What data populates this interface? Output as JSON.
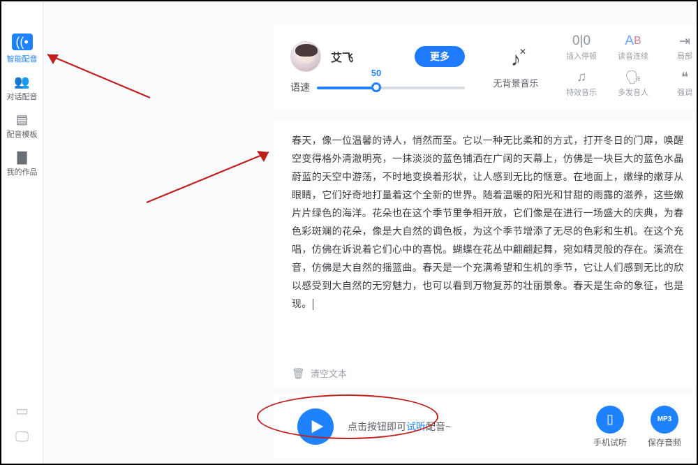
{
  "sidebar": {
    "items": [
      {
        "label": "智能配音",
        "icon": "sound-wave-icon",
        "active": true
      },
      {
        "label": "对话配音",
        "icon": "people-icon",
        "active": false
      },
      {
        "label": "配音模板",
        "icon": "document-icon",
        "active": false
      },
      {
        "label": "我的作品",
        "icon": "folder-icon",
        "active": false
      }
    ],
    "devices": [
      "phone",
      "monitor"
    ]
  },
  "voice": {
    "name": "艾飞",
    "more_label": "更多",
    "speed_label": "语速",
    "speed_value": 50,
    "speed_min": 0,
    "speed_max": 100,
    "bgm_label": "无背景音乐"
  },
  "tools": [
    {
      "name": "insert-pause",
      "icon": "pause-split-icon",
      "label": "插入停顿"
    },
    {
      "name": "continuous-read",
      "icon": "ab-link-icon",
      "label": "读音连续"
    },
    {
      "name": "local",
      "icon": "partial-icon",
      "label": "局部"
    },
    {
      "name": "sfx",
      "icon": "music-note-icon",
      "label": "特效音乐"
    },
    {
      "name": "multi-speaker",
      "icon": "multi-voice-icon",
      "label": "多发音人"
    },
    {
      "name": "emphasis",
      "icon": "emphasis-icon",
      "label": "强调"
    }
  ],
  "essay": {
    "text": "春天，像一位温馨的诗人，悄然而至。它以一种无比柔和的方式，打开冬日的门扉，唤醒\n空变得格外清澈明亮，一抹淡淡的蓝色铺洒在广阔的天幕上，仿佛是一块巨大的蓝色水晶\n蔚蓝的天空中游荡，不时地变换着形状，让人感到无比的惬意。在地面上，嫩绿的嫩芽从\n眼睛，它们好奇地打量着这个全新的世界。随着温暖的阳光和甘甜的雨露的滋养，这些嫩\n片片绿色的海洋。花朵也在这个季节里争相开放，它们像是在进行一场盛大的庆典，为春\n色彩斑斓的花朵，像是大自然的调色板，为这个季节增添了无尽的色彩和生机。在这个充\n唱，仿佛在诉说着它们心中的喜悦。蝴蝶在花丛中翩翩起舞，宛如精灵般的存在。溪流在\n音，仿佛是大自然的摇篮曲。春天是一个充满希望和生机的季节，它让人们感到无比的欣\n以感受到大自然的无穷魅力，也可以看到万物复苏的壮丽景象。春天是生命的象征，也是\n现。"
  },
  "actions": {
    "clear_label": "清空文本",
    "play_hint_pre": "点击按钮即可",
    "play_hint_try": "试听",
    "play_hint_post": "配音~"
  },
  "bottom": [
    {
      "name": "phone-listen",
      "label": "手机试听",
      "glyph": "📱"
    },
    {
      "name": "save-audio",
      "label": "保存音频",
      "glyph": "MP3"
    }
  ],
  "colors": {
    "accent": "#1e82ff",
    "annotation": "#c01f1f"
  }
}
